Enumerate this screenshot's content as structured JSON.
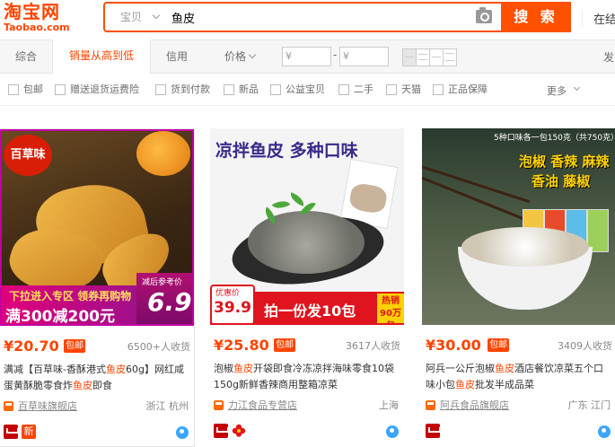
{
  "header": {
    "logo_cn": "淘宝网",
    "logo_en": "Taobao.com",
    "search_type": "宝贝",
    "search_query": "鱼皮",
    "search_button": "搜 索",
    "right_link": "在结"
  },
  "sortbar": {
    "tabs": [
      "综合",
      "销量从高到低",
      "信用",
      "价格"
    ],
    "active_tab": "销量从高到低",
    "price_min_placeholder": "¥",
    "price_max_placeholder": "¥",
    "dash": "-",
    "right_label": "发"
  },
  "filters": {
    "items": [
      "包邮",
      "赠送退货运费险",
      "货到付款",
      "新品",
      "公益宝贝",
      "二手",
      "天猫",
      "正品保障"
    ],
    "more": "更多"
  },
  "products": [
    {
      "price": "¥20.70",
      "shipping": "包邮",
      "sales": "6500+人收货",
      "title_pre": "满减【百草味-香酥港式",
      "title_kw1": "鱼皮",
      "title_mid": "60g】网红咸蛋黄酥脆零食炸",
      "title_kw2": "鱼皮",
      "title_post": "即食",
      "shop": "百草味旗舰店",
      "location": "浙江 杭州",
      "badge_new": "新",
      "img": {
        "brand": "百草味",
        "promo_line1": "下拉进入专区 领券再购物",
        "promo_line2": "满300减200元",
        "promo_small": "减后参考价",
        "promo_price": "6.9"
      }
    },
    {
      "price": "¥25.80",
      "shipping": "包邮",
      "sales": "3617人收货",
      "title_pre": "泡椒",
      "title_kw1": "鱼皮",
      "title_mid": "开袋即食冷冻凉拌海味零食10袋150g新鲜香辣商用整箱凉菜",
      "title_kw2": "",
      "title_post": "",
      "shop": "力江食品专营店",
      "location": "上海",
      "img": {
        "headline": "凉拌鱼皮 多种口味",
        "price_label": "优惠价",
        "price_value": "39.9",
        "bar_text": "拍一份发10包",
        "hot_text": "热销90万包"
      }
    },
    {
      "price": "¥30.00",
      "shipping": "包邮",
      "sales": "3409人收货",
      "title_pre": "阿兵一公斤泡椒",
      "title_kw1": "鱼皮",
      "title_mid": "酒店餐饮凉菜五个口味小包",
      "title_kw2": "鱼皮",
      "title_post": "批发半成品菜",
      "shop": "阿兵食品旗舰店",
      "location": "广东 江门",
      "img": {
        "note": "5种口味各一包150克（共750克）",
        "headline1": "泡椒 香辣 麻辣",
        "headline2": "香油 藤椒"
      }
    }
  ],
  "colors": {
    "brand": "#ff5000",
    "price": "#ff4400",
    "tmall": "#c40000"
  }
}
